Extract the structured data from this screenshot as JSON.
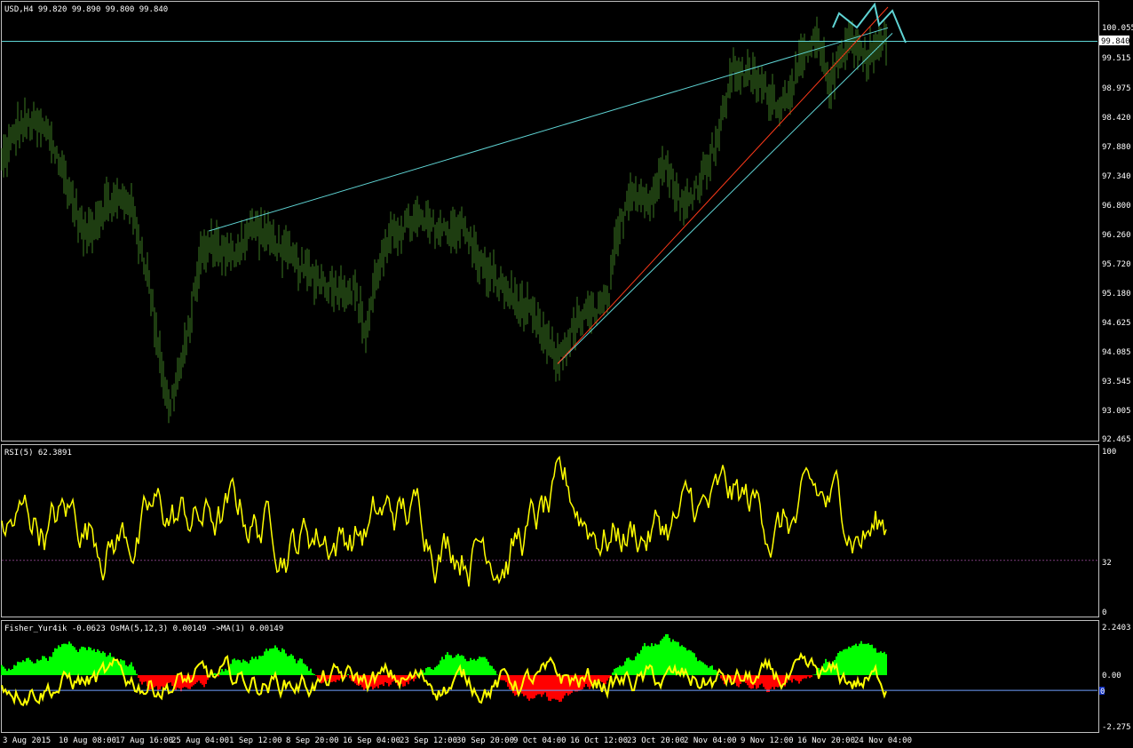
{
  "colors": {
    "background": "#000000",
    "frame": "#c0c0c0",
    "candles": "#3d7a22",
    "channel_lines": "#5fd4d4",
    "trend_line": "#ff3a1a",
    "rsi": "#ffff00",
    "rsi_level": "#7a3a7a",
    "osma_positive": "#00ff00",
    "osma_negative": "#ff0000",
    "fisher": "#ffff00",
    "fisher_signal": "#6fa0ff",
    "text": "#ffffff"
  },
  "main": {
    "header": "USD,H4  99.820 99.890 99.800 99.840",
    "price_ticks": [
      "100.055",
      "99.515",
      "98.975",
      "98.420",
      "97.880",
      "97.340",
      "96.800",
      "96.260",
      "95.720",
      "95.180",
      "94.625",
      "94.085",
      "93.545",
      "93.005",
      "92.465"
    ],
    "current_price_label": "99.840"
  },
  "rsi": {
    "header": "RSI(5) 62.3891",
    "ticks": [
      "100",
      "32",
      "0"
    ]
  },
  "fisher": {
    "header": "Fisher_Yur4ik -0.0623  OsMA(5,12,3) 0.00149  ->MA(1) 0.00149",
    "ticks": [
      "2.2403",
      "0.00",
      "-2.275"
    ],
    "right_marker": "0"
  },
  "time_axis": [
    "3 Aug 2015",
    "10 Aug 08:00",
    "17 Aug 16:00",
    "25 Aug 04:00",
    "1 Sep 12:00",
    "8 Sep 20:00",
    "16 Sep 04:00",
    "23 Sep 12:00",
    "30 Sep 20:00",
    "9 Oct 04:00",
    "16 Oct 12:00",
    "23 Oct 20:00",
    "2 Nov 04:00",
    "9 Nov 12:00",
    "16 Nov 20:00",
    "24 Nov 04:00"
  ],
  "chart_data": {
    "type": "line",
    "price_anchors": [
      [
        0,
        97.5
      ],
      [
        20,
        98.2
      ],
      [
        35,
        98.3
      ],
      [
        55,
        98.1
      ],
      [
        75,
        97.2
      ],
      [
        95,
        96.2
      ],
      [
        120,
        96.8
      ],
      [
        145,
        96.9
      ],
      [
        165,
        95.6
      ],
      [
        190,
        93.0
      ],
      [
        210,
        94.2
      ],
      [
        225,
        95.8
      ],
      [
        240,
        96.1
      ],
      [
        260,
        95.8
      ],
      [
        285,
        96.4
      ],
      [
        310,
        96.1
      ],
      [
        340,
        95.6
      ],
      [
        370,
        95.3
      ],
      [
        400,
        95.2
      ],
      [
        412,
        94.4
      ],
      [
        425,
        95.6
      ],
      [
        445,
        96.3
      ],
      [
        470,
        96.5
      ],
      [
        500,
        96.3
      ],
      [
        520,
        96.4
      ],
      [
        545,
        95.6
      ],
      [
        570,
        95.2
      ],
      [
        600,
        94.7
      ],
      [
        628,
        93.9
      ],
      [
        650,
        94.6
      ],
      [
        685,
        95.0
      ],
      [
        693,
        96.0
      ],
      [
        710,
        97.1
      ],
      [
        735,
        96.8
      ],
      [
        745,
        97.7
      ],
      [
        770,
        96.7
      ],
      [
        790,
        97.3
      ],
      [
        810,
        98.1
      ],
      [
        825,
        99.3
      ],
      [
        850,
        99.1
      ],
      [
        880,
        98.6
      ],
      [
        905,
        99.5
      ],
      [
        920,
        99.8
      ],
      [
        935,
        99.0
      ],
      [
        955,
        99.9
      ],
      [
        975,
        99.5
      ],
      [
        998,
        99.84
      ]
    ],
    "rsi_level": 32,
    "fisher_zero": 0.0
  }
}
